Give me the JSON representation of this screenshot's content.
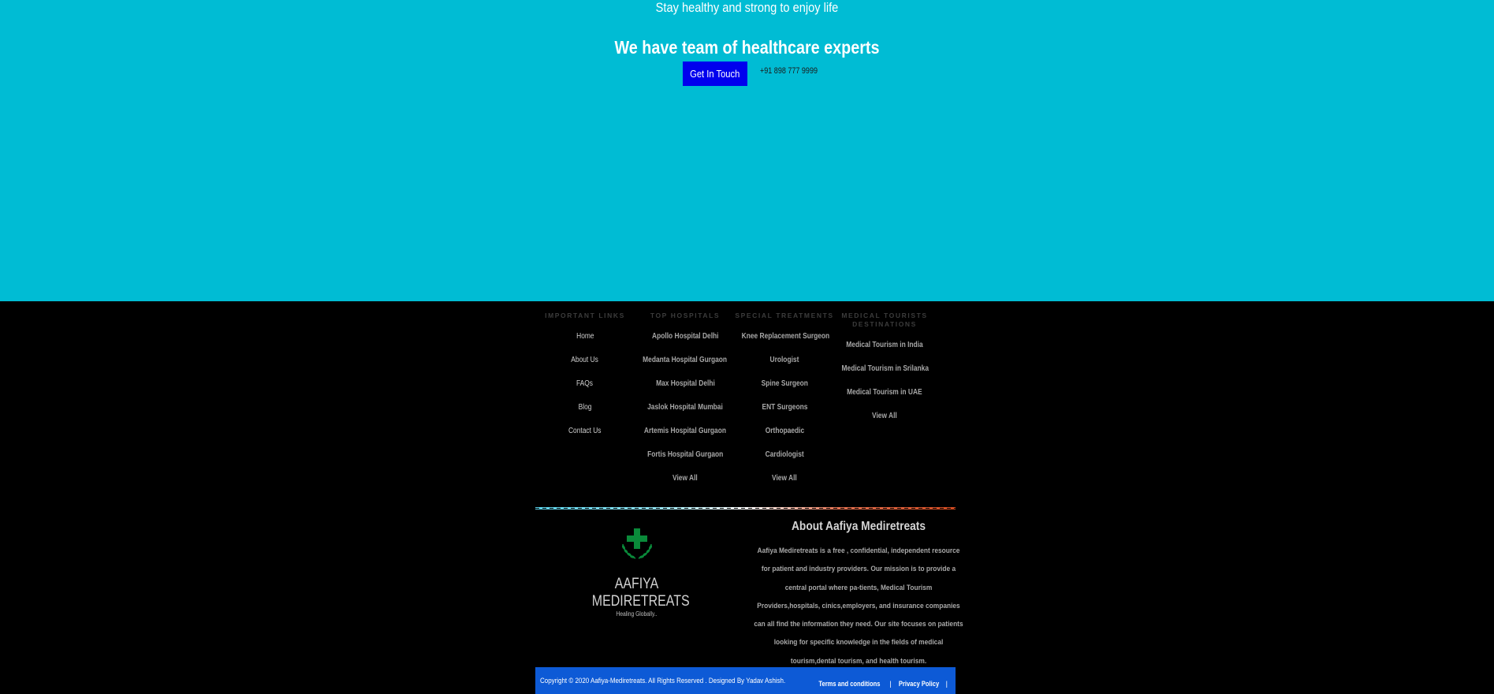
{
  "hero": {
    "tagline": "Stay healthy and strong to enjoy life",
    "heading": "We have team of healthcare experts",
    "cta_label": "Get In Touch",
    "phone": "+91 898 777 9999"
  },
  "footer": {
    "columns": [
      {
        "title": "IMPORTANT LINKS",
        "links": [
          "Home",
          "About Us",
          "FAQs",
          "Blog",
          "Contact Us"
        ]
      },
      {
        "title": "TOP HOSPITALS",
        "links": [
          "Apollo Hospital Delhi",
          "Medanta Hospital Gurgaon",
          "Max Hospital Delhi",
          "Jaslok Hospital Mumbai",
          "Artemis Hospital Gurgaon",
          "Fortis Hospital Gurgaon",
          "View All"
        ]
      },
      {
        "title": "SPECIAL TREATMENTS",
        "links": [
          "Knee Replacement Surgeon",
          "Urologist",
          "Spine Surgeon",
          "ENT Surgeons",
          "Orthopaedic",
          "Cardiologist",
          "View All"
        ]
      },
      {
        "title": "MEDICAL TOURISTS DESTINATIONS",
        "links": [
          "Medical Tourism in India",
          "Medical Tourism in Srilanka",
          "Medical Tourism in UAE",
          "View All"
        ]
      }
    ],
    "logo": {
      "name": "AAFIYA MEDIRETREATS",
      "tagline": "Healing Globally..",
      "icon": "medical-cross-laurel-icon",
      "icon_color": "#0a8a3a"
    },
    "about": {
      "title": "About Aafiya Mediretreats",
      "text": "Aafiya Mediretreats is a free , confidential, independent resource for patient and industry providers. Our mission is to provide a central portal where pa-tients, Medical Tourism Providers,hospitals, cinics,employers, and insurance companies can all find the information they need. Our site focuses on patients looking for specific knowledge in the fields of medical tourism,dental tourism, and health tourism."
    },
    "bottom": {
      "copyright": "Copyright © 2020 Aafiya-Mediretreats. All Rights Reserved . Designed By Yadav Ashish.",
      "terms": "Terms and conditions",
      "privacy": "Privacy Policy",
      "separator": "|"
    }
  },
  "colors": {
    "hero_bg": "#00bcd4",
    "cta_bg": "#0000ee",
    "footer_bg": "#000000",
    "bottom_bar_bg": "#0d5ad6"
  }
}
